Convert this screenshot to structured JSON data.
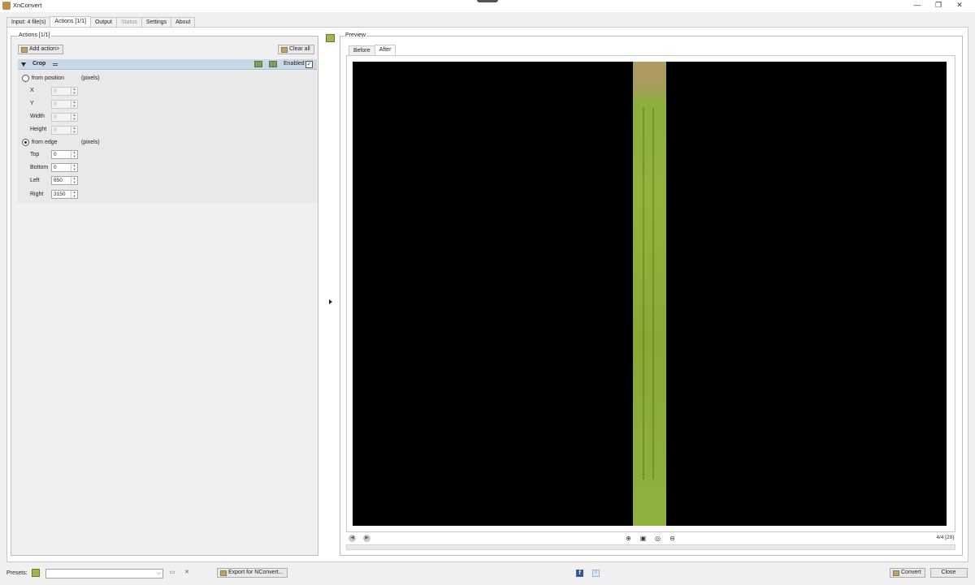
{
  "window": {
    "title": "XnConvert",
    "minimize": "—",
    "restore": "❐",
    "close": "✕"
  },
  "tabs": [
    {
      "label": "Input: 4 file(s)"
    },
    {
      "label": "Actions [1/1]"
    },
    {
      "label": "Output"
    },
    {
      "label": "Status"
    },
    {
      "label": "Settings"
    },
    {
      "label": "About"
    }
  ],
  "actions": {
    "title": "Actions [1/1]",
    "add_label": "Add action>",
    "clear_label": "Clear all",
    "crop": {
      "label": "Crop",
      "enabled_label": "Enabled",
      "enabled_mark": "✓",
      "from_position_label": "from position",
      "from_edge_label": "from edge",
      "units_label": "(pixels)",
      "x_label": "X",
      "x_value": "0",
      "y_label": "Y",
      "y_value": "0",
      "width_label": "Width",
      "width_value": "0",
      "height_label": "Height",
      "height_value": "0",
      "top_label": "Top",
      "top_value": "0",
      "bottom_label": "Bottom",
      "bottom_value": "0",
      "left_label": "Left",
      "left_value": "650",
      "right_label": "Right",
      "right_value": "3150"
    }
  },
  "preview": {
    "title": "Preview",
    "tabs": [
      {
        "label": "Before"
      },
      {
        "label": "After"
      }
    ],
    "pager": "4/4 [29]",
    "zoom_in": "⊕",
    "fit": "▣",
    "actual": "◎",
    "zoom_out": "⊖",
    "prev": "◀",
    "next": "▶"
  },
  "bottom": {
    "presets_label": "Presets:",
    "export_label": "Export for NConvert...",
    "convert_label": "Convert",
    "close_label": "Close",
    "dropdown_glyph": "⌵",
    "save_glyph": "▭",
    "delete_glyph": "✕",
    "facebook_glyph": "f",
    "twitter_glyph": "t"
  }
}
